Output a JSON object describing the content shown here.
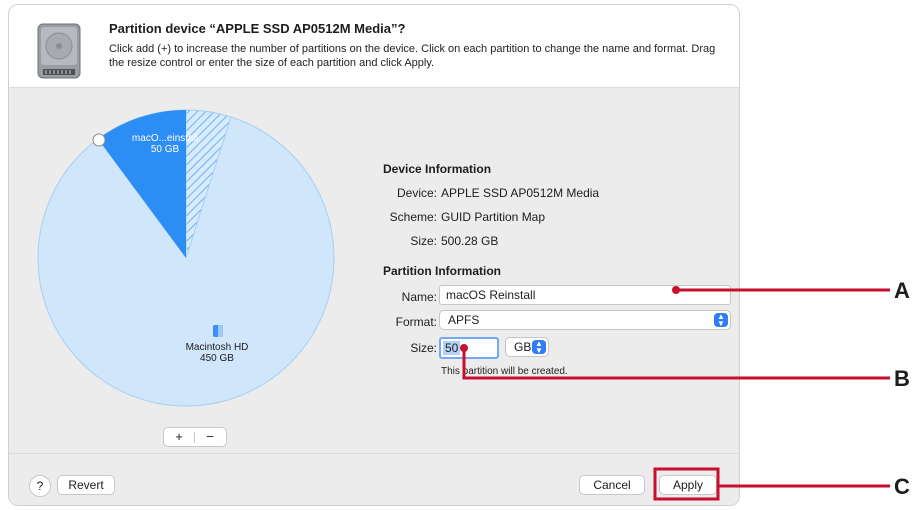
{
  "dialog": {
    "title": "Partition device “APPLE SSD AP0512M Media”?",
    "description": "Click add (+) to increase the number of partitions on the device. Click on each partition to change the name and format. Drag the resize control or enter the size of each partition and click Apply."
  },
  "pie": {
    "slices": [
      {
        "name": "macO...einstall",
        "size": "50 GB",
        "fraction": 0.1
      },
      {
        "name": "Macintosh HD",
        "size": "450 GB",
        "fraction": 0.9
      }
    ],
    "add_symbol": "+",
    "remove_symbol": "−"
  },
  "device_info": {
    "heading": "Device Information",
    "device_label": "Device:",
    "device_value": "APPLE SSD AP0512M Media",
    "scheme_label": "Scheme:",
    "scheme_value": "GUID Partition Map",
    "size_label": "Size:",
    "size_value": "500.28 GB"
  },
  "partition_info": {
    "heading": "Partition Information",
    "name_label": "Name:",
    "name_value": "macOS Reinstall",
    "format_label": "Format:",
    "format_value": "APFS",
    "size_label": "Size:",
    "size_value": "50",
    "unit_value": "GB",
    "hint": "This partition will be created."
  },
  "footer": {
    "help": "?",
    "revert": "Revert",
    "cancel": "Cancel",
    "apply": "Apply"
  },
  "callouts": {
    "a": "A",
    "b": "B",
    "c": "C"
  },
  "colors": {
    "slice_new": "#2c8df5",
    "slice_main": "#cfe6fb",
    "callout": "#c8102e",
    "accent": "#2f7cf6"
  }
}
